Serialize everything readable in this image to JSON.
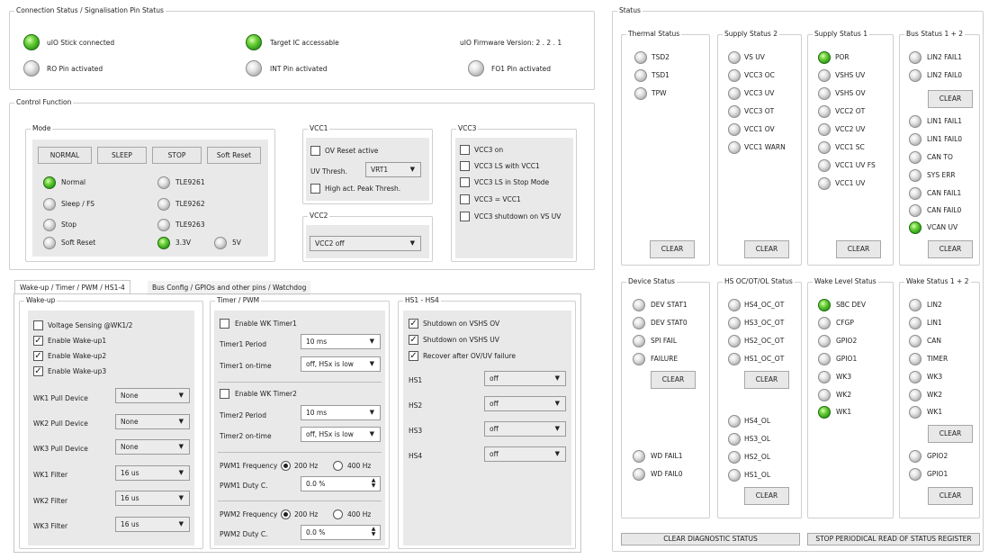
{
  "connection": {
    "title": "Connection Status / Signalisation Pin Status",
    "items": [
      {
        "label": "uIO Stick connected",
        "on": true
      },
      {
        "label": "Target IC accessable",
        "on": true
      },
      {
        "label": "RO Pin activated",
        "on": false
      },
      {
        "label": "INT Pin activated",
        "on": false
      },
      {
        "label": "FO1 Pin activated",
        "on": false
      }
    ],
    "firmware": "uIO Firmware Version:  2  .  2  .  1"
  },
  "control": {
    "title": "Control Function",
    "mode": {
      "title": "Mode",
      "buttons": [
        "NORMAL",
        "SLEEP",
        "STOP",
        "Soft Reset"
      ],
      "leds": [
        {
          "label": "Normal",
          "on": true
        },
        {
          "label": "Sleep / FS",
          "on": false
        },
        {
          "label": "Stop",
          "on": false
        },
        {
          "label": "Soft Reset",
          "on": false
        },
        {
          "label": "TLE9261",
          "on": false
        },
        {
          "label": "TLE9262",
          "on": false
        },
        {
          "label": "TLE9263",
          "on": false
        },
        {
          "label": "3.3V",
          "on": true
        },
        {
          "label": "5V",
          "on": false
        }
      ]
    },
    "vcc1": {
      "title": "VCC1",
      "ov_reset": "OV Reset active",
      "uv_thresh_label": "UV Thresh.",
      "uv_thresh_value": "VRT1",
      "high_peak": "High act. Peak Thresh."
    },
    "vcc2": {
      "title": "VCC2",
      "value": "VCC2 off"
    },
    "vcc3": {
      "title": "VCC3",
      "options": [
        "VCC3 on",
        "VCC3 LS with VCC1",
        "VCC3 LS in Stop Mode",
        "VCC3 = VCC1",
        "VCC3 shutdown on VS UV"
      ]
    }
  },
  "tabs": [
    "Wake-up / Timer / PWM / HS1-4",
    "Bus Config / GPIOs and other pins / Watchdog"
  ],
  "wakeup": {
    "title": "Wake-up",
    "checks": [
      {
        "label": "Voltage Sensing @WK1/2",
        "checked": false
      },
      {
        "label": "Enable Wake-up1",
        "checked": true
      },
      {
        "label": "Enable Wake-up2",
        "checked": true
      },
      {
        "label": "Enable Wake-up3",
        "checked": true
      }
    ],
    "selects": [
      {
        "label": "WK1 Pull Device",
        "value": "None"
      },
      {
        "label": "WK2 Pull Device",
        "value": "None"
      },
      {
        "label": "WK3 Pull Device",
        "value": "None"
      },
      {
        "label": "WK1 Filter",
        "value": "16 us"
      },
      {
        "label": "WK2 Filter",
        "value": "16 us"
      },
      {
        "label": "WK3 Filter",
        "value": "16 us"
      }
    ]
  },
  "timer": {
    "title": "Timer / PWM",
    "timer1": {
      "enable": "Enable WK Timer1",
      "period_label": "Timer1 Period",
      "period": "10 ms",
      "ontime_label": "Timer1 on-time",
      "ontime": "off, HSx is low"
    },
    "timer2": {
      "enable": "Enable WK Timer2",
      "period_label": "Timer2 Period",
      "period": "10 ms",
      "ontime_label": "Timer2 on-time",
      "ontime": "off, HSx is low"
    },
    "pwm1": {
      "freq_label": "PWM1 Frequency",
      "f1": "200 Hz",
      "f2": "400 Hz",
      "duty_label": "PWM1 Duty C.",
      "duty": "0.0 %"
    },
    "pwm2": {
      "freq_label": "PWM2 Frequency",
      "f1": "200 Hz",
      "f2": "400 Hz",
      "duty_label": "PWM2 Duty C.",
      "duty": "0.0 %"
    }
  },
  "hs": {
    "title": "HS1 - HS4",
    "checks": [
      {
        "label": "Shutdown on VSHS OV",
        "checked": true
      },
      {
        "label": "Shutdown on VSHS UV",
        "checked": true
      },
      {
        "label": "Recover after OV/UV failure",
        "checked": true
      }
    ],
    "selects": [
      {
        "label": "HS1",
        "value": "off"
      },
      {
        "label": "HS2",
        "value": "off"
      },
      {
        "label": "HS3",
        "value": "off"
      },
      {
        "label": "HS4",
        "value": "off"
      }
    ]
  },
  "status": {
    "title": "Status",
    "clear": "CLEAR",
    "thermal": {
      "title": "Thermal Status",
      "items": [
        {
          "label": "TSD2",
          "on": false
        },
        {
          "label": "TSD1",
          "on": false
        },
        {
          "label": "TPW",
          "on": false
        }
      ]
    },
    "supply2": {
      "title": "Supply Status 2",
      "items": [
        {
          "label": "VS UV",
          "on": false
        },
        {
          "label": "VCC3 OC",
          "on": false
        },
        {
          "label": "VCC3 UV",
          "on": false
        },
        {
          "label": "VCC3 OT",
          "on": false
        },
        {
          "label": "VCC1 OV",
          "on": false
        },
        {
          "label": "VCC1 WARN",
          "on": false
        }
      ]
    },
    "supply1": {
      "title": "Supply Status 1",
      "items": [
        {
          "label": "POR",
          "on": true
        },
        {
          "label": "VSHS UV",
          "on": false
        },
        {
          "label": "VSHS OV",
          "on": false
        },
        {
          "label": "VCC2 OT",
          "on": false
        },
        {
          "label": "VCC2 UV",
          "on": false
        },
        {
          "label": "VCC1 SC",
          "on": false
        },
        {
          "label": "VCC1 UV FS",
          "on": false
        },
        {
          "label": "VCC1 UV",
          "on": false
        }
      ]
    },
    "bus": {
      "title": "Bus Status 1 + 2",
      "top": [
        {
          "label": "LIN2 FAIL1",
          "on": false
        },
        {
          "label": "LIN2 FAIL0",
          "on": false
        }
      ],
      "bottom": [
        {
          "label": "LIN1 FAIL1",
          "on": false
        },
        {
          "label": "LIN1 FAIL0",
          "on": false
        },
        {
          "label": "CAN TO",
          "on": false
        },
        {
          "label": "SYS ERR",
          "on": false
        },
        {
          "label": "CAN FAIL1",
          "on": false
        },
        {
          "label": "CAN FAIL0",
          "on": false
        },
        {
          "label": "VCAN UV",
          "on": true
        }
      ]
    },
    "device": {
      "title": "Device Status",
      "top": [
        {
          "label": "DEV STAT1",
          "on": false
        },
        {
          "label": "DEV STAT0",
          "on": false
        },
        {
          "label": "SPI FAIL",
          "on": false
        },
        {
          "label": "FAILURE",
          "on": false
        }
      ],
      "bottom": [
        {
          "label": "WD FAIL1",
          "on": false
        },
        {
          "label": "WD FAIL0",
          "on": false
        }
      ]
    },
    "hsoc": {
      "title": "HS OC/OT/OL Status",
      "top": [
        {
          "label": "HS4_OC_OT",
          "on": false
        },
        {
          "label": "HS3_OC_OT",
          "on": false
        },
        {
          "label": "HS2_OC_OT",
          "on": false
        },
        {
          "label": "HS1_OC_OT",
          "on": false
        }
      ],
      "bottom": [
        {
          "label": "HS4_OL",
          "on": false
        },
        {
          "label": "HS3_OL",
          "on": false
        },
        {
          "label": "HS2_OL",
          "on": false
        },
        {
          "label": "HS1_OL",
          "on": false
        }
      ]
    },
    "wakelevel": {
      "title": "Wake Level Status",
      "items": [
        {
          "label": "SBC DEV",
          "on": true
        },
        {
          "label": "CFGP",
          "on": false
        },
        {
          "label": "GPIO2",
          "on": false
        },
        {
          "label": "GPIO1",
          "on": false
        },
        {
          "label": "WK3",
          "on": false
        },
        {
          "label": "WK2",
          "on": false
        },
        {
          "label": "WK1",
          "on": true
        }
      ]
    },
    "wake12": {
      "title": "Wake Status 1 + 2",
      "top": [
        {
          "label": "LIN2",
          "on": false
        },
        {
          "label": "LIN1",
          "on": false
        },
        {
          "label": "CAN",
          "on": false
        },
        {
          "label": "TIMER",
          "on": false
        },
        {
          "label": "WK3",
          "on": false
        },
        {
          "label": "WK2",
          "on": false
        },
        {
          "label": "WK1",
          "on": false
        }
      ],
      "bottom": [
        {
          "label": "GPIO2",
          "on": false
        },
        {
          "label": "GPIO1",
          "on": false
        }
      ]
    },
    "clear_diag": "CLEAR DIAGNOSTIC STATUS",
    "stop_read": "STOP PERIODICAL READ OF STATUS REGISTER"
  }
}
